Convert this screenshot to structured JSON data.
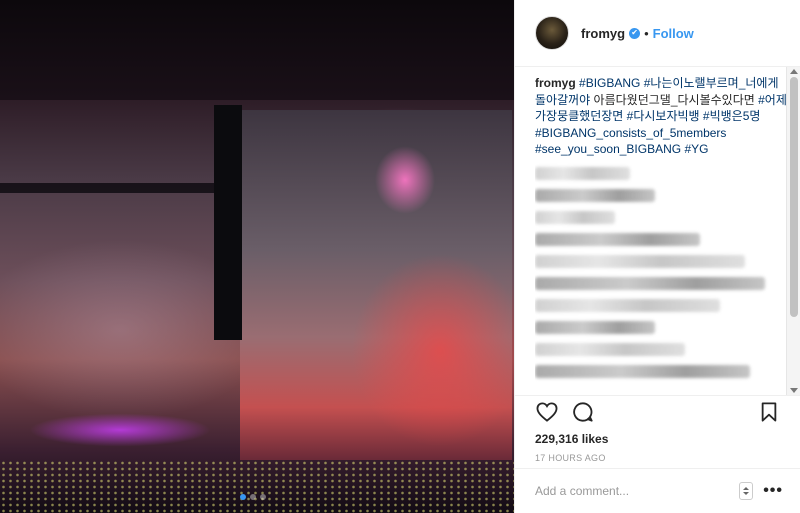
{
  "post": {
    "username": "fromyg",
    "follow_label": "Follow",
    "separator": "•",
    "verified_mark": "✔",
    "caption": {
      "user": "fromyg",
      "tags": [
        "#BIGBANG",
        "#나는이노랠부르며_너에게돌아갈꺼야",
        "아름다웠던그댈_다시볼수있다면",
        "#어제가장뭉클했던장면",
        "#다시보자빅뱅",
        "#빅뱅은5명",
        "#BIGBANG_consists_of_5members",
        "#see_you_soon_BIGBANG",
        "#YG"
      ]
    },
    "likes": "229,316 likes",
    "time": "17 HOURS AGO",
    "comment_placeholder": "Add a comment...",
    "more_label": "•••"
  },
  "icons": {
    "like": "heart-icon",
    "comment": "comment-icon",
    "save": "bookmark-icon",
    "options": "more-icon",
    "verified": "verified-badge-icon"
  },
  "carousel": {
    "count": 3,
    "active_index": 0
  },
  "colors": {
    "accent": "#3897f0",
    "hashtag": "#003569",
    "muted": "#999999"
  }
}
